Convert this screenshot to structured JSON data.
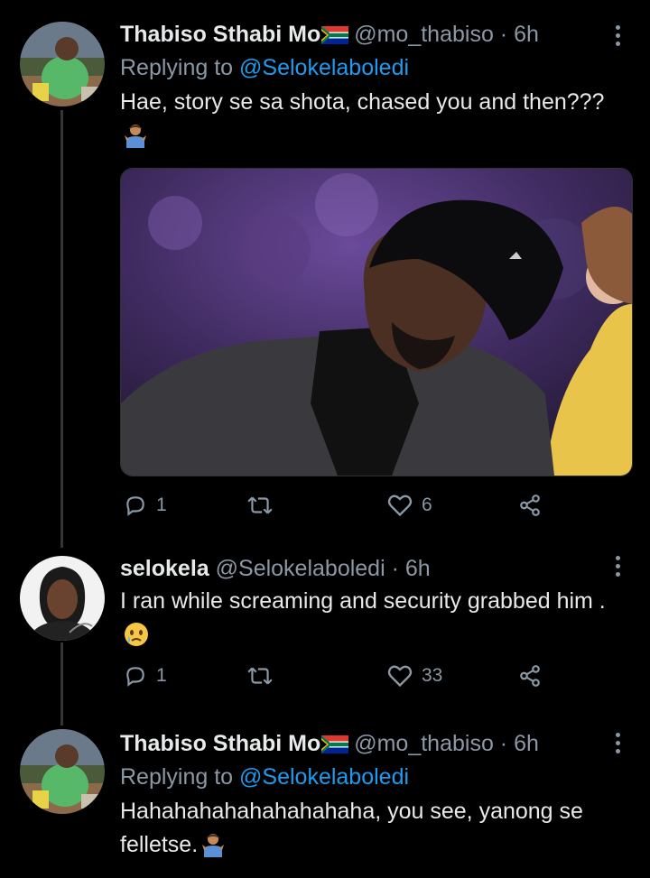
{
  "tweets": [
    {
      "author_name": "Thabiso Sthabi Mo",
      "handle": "@mo_thabiso",
      "time": "6h",
      "replying_label": "Replying to",
      "replying_to": "@Selokelaboledi",
      "text": "Hae, story se sa shota, chased you and then???",
      "emoji": "person-shrugging",
      "media_description": "photo-of-man-in-black-cap",
      "reply_count": "1",
      "retweet_count": "",
      "like_count": "6"
    },
    {
      "author_name": "selokela",
      "handle": "@Selokelaboledi",
      "time": "6h",
      "text": "I ran while screaming and security grabbed him .",
      "emoji": "crying-face",
      "reply_count": "1",
      "retweet_count": "",
      "like_count": "33"
    },
    {
      "author_name": "Thabiso Sthabi Mo",
      "handle": "@mo_thabiso",
      "time": "6h",
      "replying_label": "Replying to",
      "replying_to": "@Selokelaboledi",
      "text": "Hahahahahahahahahaha, you see, yanong se felletse.",
      "emoji": "person-shrugging"
    }
  ],
  "colors": {
    "background": "#000000",
    "primary_text": "#e7e9ea",
    "secondary_text": "#8b98a5",
    "link": "#1d9bf0"
  }
}
